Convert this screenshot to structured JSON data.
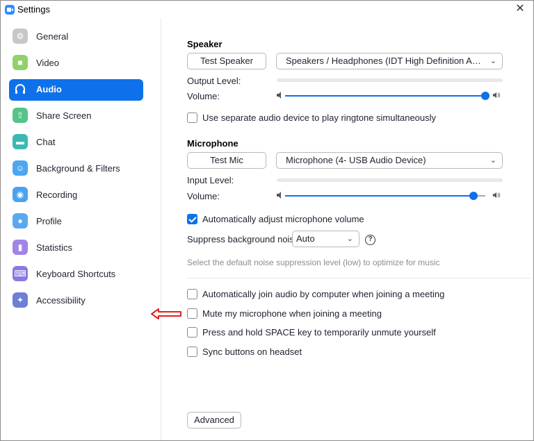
{
  "window": {
    "title": "Settings"
  },
  "sidebar": {
    "items": [
      {
        "label": "General",
        "icon": "gear-icon",
        "active": false
      },
      {
        "label": "Video",
        "icon": "video-camera-icon",
        "active": false
      },
      {
        "label": "Audio",
        "icon": "headphones-icon",
        "active": true
      },
      {
        "label": "Share Screen",
        "icon": "share-screen-icon",
        "active": false
      },
      {
        "label": "Chat",
        "icon": "chat-bubble-icon",
        "active": false
      },
      {
        "label": "Background & Filters",
        "icon": "person-background-icon",
        "active": false
      },
      {
        "label": "Recording",
        "icon": "record-icon",
        "active": false
      },
      {
        "label": "Profile",
        "icon": "person-icon",
        "active": false
      },
      {
        "label": "Statistics",
        "icon": "bar-chart-icon",
        "active": false
      },
      {
        "label": "Keyboard Shortcuts",
        "icon": "keyboard-icon",
        "active": false
      },
      {
        "label": "Accessibility",
        "icon": "accessibility-icon",
        "active": false
      }
    ]
  },
  "speaker": {
    "title": "Speaker",
    "test_button": "Test Speaker",
    "device": "Speakers / Headphones (IDT High Definition Audio ...",
    "output_level_label": "Output Level:",
    "volume_label": "Volume:",
    "volume_fraction": 1.0
  },
  "separate_device": {
    "label": "Use separate audio device to play ringtone simultaneously",
    "checked": false
  },
  "microphone": {
    "title": "Microphone",
    "test_button": "Test Mic",
    "device": "Microphone (4- USB Audio Device)",
    "input_level_label": "Input Level:",
    "volume_label": "Volume:",
    "volume_fraction": 0.94
  },
  "auto_adjust": {
    "label": "Automatically adjust microphone volume",
    "checked": true
  },
  "noise": {
    "label": "Suppress background noise",
    "value": "Auto",
    "hint": "Select the default noise suppression level (low) to optimize for music"
  },
  "options": [
    {
      "label": "Automatically join audio by computer when joining a meeting",
      "checked": false
    },
    {
      "label": "Mute my microphone when joining a meeting",
      "checked": false
    },
    {
      "label": "Press and hold SPACE key to temporarily unmute yourself",
      "checked": false
    },
    {
      "label": "Sync buttons on headset",
      "checked": false
    }
  ],
  "advanced_button": "Advanced",
  "colors": {
    "accent": "#0e71eb",
    "annotation_arrow": "#e02020"
  }
}
